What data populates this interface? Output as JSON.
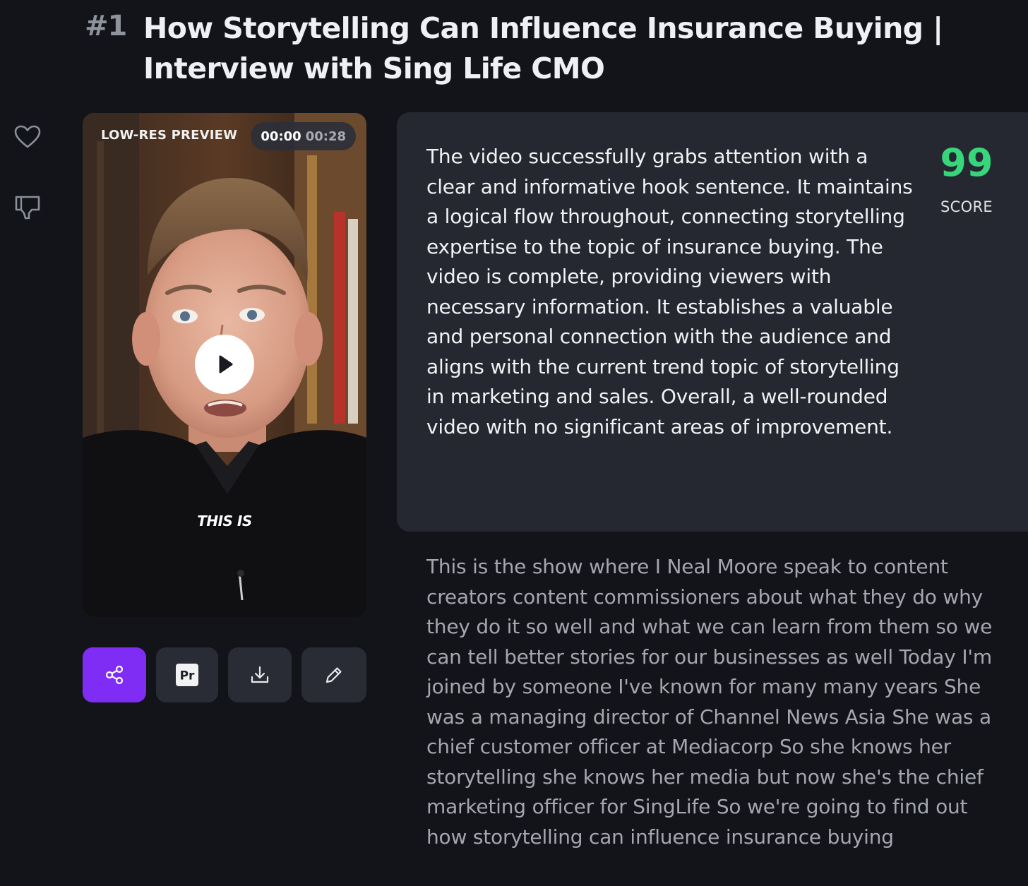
{
  "header": {
    "rank": "#1",
    "title": "How Storytelling Can Influence Insurance Buying | Interview with Sing Life CMO"
  },
  "rail": {
    "like_icon": "heart-icon",
    "dislike_icon": "thumbs-down-icon"
  },
  "video": {
    "preview_label": "LOW-RES PREVIEW",
    "time_current": "00:00",
    "time_total": "00:28",
    "caption": "THIS IS",
    "play_icon": "play-icon"
  },
  "actions": [
    {
      "icon": "share-icon"
    },
    {
      "icon": "premiere-pro-icon",
      "label": "Pr"
    },
    {
      "icon": "download-icon"
    },
    {
      "icon": "edit-pencil-icon"
    }
  ],
  "analysis": {
    "text": "The video successfully grabs attention with a clear and informative hook sentence. It maintains a logical flow throughout, connecting storytelling expertise to the topic of insurance buying. The video is complete, providing viewers with necessary information. It establishes a valuable and personal connection with the audience and aligns with the current trend topic of storytelling in marketing and sales. Overall, a well-rounded video with no significant areas of improvement.",
    "score": "99",
    "score_label": "SCORE"
  },
  "transcript": {
    "text": "This is the show where I Neal Moore speak to content creators content commissioners about what they do why they do it so well and what we can learn from them so we can tell better stories for our businesses as well Today I'm joined by someone I've known for many many years She was a managing director of Channel News Asia She was a chief customer officer at Mediacorp So she knows her storytelling she knows her media but now she's the chief marketing officer for SingLife So we're going to find out how storytelling can influence insurance buying"
  },
  "colors": {
    "background": "#131419",
    "card": "#262831",
    "accent": "#7f2cf5",
    "score": "#37d67a",
    "button": "#2a2c35"
  }
}
